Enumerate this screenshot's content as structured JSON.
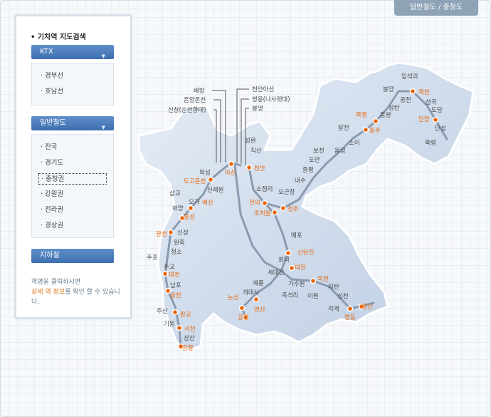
{
  "header": {
    "breadcrumb": "일반철도 / 충청도"
  },
  "sidebar": {
    "title": "• 기차역 지도검색",
    "ktx": {
      "label": "KTX",
      "items": [
        "· 경부선",
        "· 호남선"
      ]
    },
    "general": {
      "label": "일반철도",
      "items": [
        "· 전국",
        "· 경기도",
        "· 충청권",
        "· 강원권",
        "· 전라권",
        "· 경상권"
      ],
      "selected_index": 2
    },
    "subway": {
      "label": "지하철"
    },
    "note_part1": "역명을 클릭하시면",
    "note_em": "상세 역 정보",
    "note_part2": "를 확인 할 수 있습니다."
  },
  "map": {
    "colors": {
      "highlight": "#e8650a",
      "line": "#8a9bb0",
      "land": "#cdd9ea"
    },
    "stations": [
      {
        "name": "배방",
        "highlight": false
      },
      {
        "name": "온양온천",
        "highlight": false
      },
      {
        "name": "신창(순천향대)",
        "highlight": false
      },
      {
        "name": "천안아산",
        "highlight": false
      },
      {
        "name": "쌍용(나사렛대)",
        "highlight": false
      },
      {
        "name": "봉명",
        "highlight": false
      },
      {
        "name": "성환",
        "highlight": false
      },
      {
        "name": "직산",
        "highlight": false
      },
      {
        "name": "천안",
        "highlight": true
      },
      {
        "name": "아산",
        "highlight": true
      },
      {
        "name": "학성",
        "highlight": false
      },
      {
        "name": "도고온천",
        "highlight": true
      },
      {
        "name": "신례원",
        "highlight": false
      },
      {
        "name": "삽교",
        "highlight": false
      },
      {
        "name": "오가",
        "highlight": false
      },
      {
        "name": "예산",
        "highlight": true
      },
      {
        "name": "화양",
        "highlight": false
      },
      {
        "name": "홍성",
        "highlight": true
      },
      {
        "name": "신성",
        "highlight": false
      },
      {
        "name": "광천",
        "highlight": true
      },
      {
        "name": "원죽",
        "highlight": false
      },
      {
        "name": "청소",
        "highlight": false
      },
      {
        "name": "주포",
        "highlight": false
      },
      {
        "name": "주교",
        "highlight": false
      },
      {
        "name": "대천",
        "highlight": true
      },
      {
        "name": "남포",
        "highlight": false
      },
      {
        "name": "웅천",
        "highlight": true
      },
      {
        "name": "주산",
        "highlight": false
      },
      {
        "name": "판교",
        "highlight": true
      },
      {
        "name": "기동",
        "highlight": false
      },
      {
        "name": "서천",
        "highlight": true
      },
      {
        "name": "삼산",
        "highlight": false
      },
      {
        "name": "장항",
        "highlight": true
      },
      {
        "name": "소정리",
        "highlight": false
      },
      {
        "name": "전의",
        "highlight": true
      },
      {
        "name": "조치원",
        "highlight": true
      },
      {
        "name": "청주",
        "highlight": true
      },
      {
        "name": "오근장",
        "highlight": false
      },
      {
        "name": "내수",
        "highlight": false
      },
      {
        "name": "증평",
        "highlight": false
      },
      {
        "name": "도안",
        "highlight": false
      },
      {
        "name": "보천",
        "highlight": false
      },
      {
        "name": "음성",
        "highlight": false
      },
      {
        "name": "소이",
        "highlight": false
      },
      {
        "name": "달천",
        "highlight": false
      },
      {
        "name": "충주",
        "highlight": true
      },
      {
        "name": "목행",
        "highlight": true
      },
      {
        "name": "동량",
        "highlight": false
      },
      {
        "name": "삼탄",
        "highlight": false
      },
      {
        "name": "공전",
        "highlight": false
      },
      {
        "name": "봉양",
        "highlight": false
      },
      {
        "name": "입석리",
        "highlight": false
      },
      {
        "name": "제천",
        "highlight": true
      },
      {
        "name": "삼곡",
        "highlight": false
      },
      {
        "name": "도담",
        "highlight": false
      },
      {
        "name": "단양",
        "highlight": true
      },
      {
        "name": "단성",
        "highlight": false
      },
      {
        "name": "죽령",
        "highlight": false
      },
      {
        "name": "매포",
        "highlight": false
      },
      {
        "name": "신탄진",
        "highlight": true
      },
      {
        "name": "회덕",
        "highlight": false
      },
      {
        "name": "대전",
        "highlight": true
      },
      {
        "name": "세대전",
        "highlight": false
      },
      {
        "name": "옥천",
        "highlight": true
      },
      {
        "name": "이원",
        "highlight": false
      },
      {
        "name": "지탄",
        "highlight": false
      },
      {
        "name": "심천",
        "highlight": false
      },
      {
        "name": "각계",
        "highlight": false
      },
      {
        "name": "영동",
        "highlight": true
      },
      {
        "name": "황간",
        "highlight": true
      },
      {
        "name": "계룡",
        "highlight": false
      },
      {
        "name": "가수원",
        "highlight": false
      },
      {
        "name": "흑석리",
        "highlight": false
      },
      {
        "name": "개태사",
        "highlight": false
      },
      {
        "name": "논산",
        "highlight": true
      },
      {
        "name": "연산",
        "highlight": true
      },
      {
        "name": "강경",
        "highlight": true
      }
    ]
  }
}
